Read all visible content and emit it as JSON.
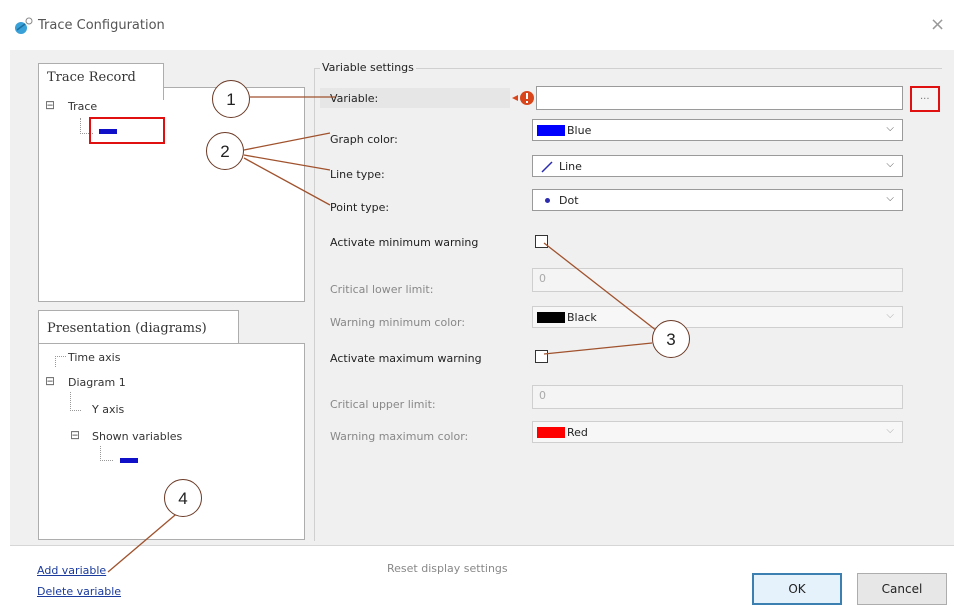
{
  "window": {
    "title": "Trace Configuration",
    "close_glyph": "×",
    "icon": "trace-config-icon"
  },
  "trace_record": {
    "header": "Trace Record",
    "root_label": "Trace",
    "expander": "⊟",
    "item_color": "#1010c8"
  },
  "presentation": {
    "header": "Presentation (diagrams)",
    "time_axis": "Time axis",
    "diagram": "Diagram 1",
    "y_axis": "Y axis",
    "shown_variables": "Shown variables",
    "expander": "⊟",
    "item_color": "#1010c8"
  },
  "settings": {
    "group_label": "Variable settings",
    "variable_label": "Variable:",
    "variable_value": "",
    "browse_label": "...",
    "graph_color_label": "Graph color:",
    "graph_color_value": "Blue",
    "graph_color_hex": "#0000ff",
    "line_type_label": "Line type:",
    "line_type_value": "Line",
    "point_type_label": "Point type:",
    "point_type_value": "Dot",
    "act_min_label": "Activate minimum warning",
    "critical_lower_label": "Critical lower limit:",
    "critical_lower_value": "0",
    "warn_min_color_label": "Warning minimum color:",
    "warn_min_color_value": "Black",
    "warn_min_color_hex": "#000000",
    "act_max_label": "Activate maximum warning",
    "critical_upper_label": "Critical upper limit:",
    "critical_upper_value": "0",
    "warn_max_color_label": "Warning maximum color:",
    "warn_max_color_value": "Red",
    "warn_max_color_hex": "#ff0000",
    "chevron": "⌵"
  },
  "footer": {
    "add_variable": "Add variable",
    "delete_variable": "Delete variable",
    "reset_display": "Reset display settings",
    "ok": "OK",
    "cancel": "Cancel"
  },
  "callouts": [
    "1",
    "2",
    "3",
    "4"
  ],
  "colors": {
    "highlight_red": "#e01010",
    "callout_line": "#a0522d",
    "dialog_bg": "#f0f0f0"
  }
}
